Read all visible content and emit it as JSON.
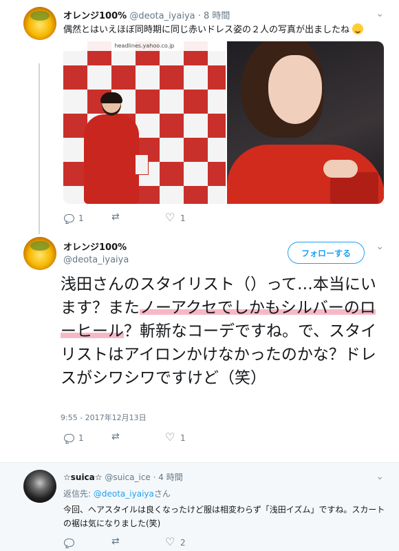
{
  "tweet1": {
    "name": "オレンジ100%",
    "handle": "@deota_iyaiya",
    "time": "· 8 時間",
    "text": "偶然とはいえほぼ同時期に同じ赤いドレス姿の２人の写真が出ましたね",
    "emoji_icon": "smiling-face-icon",
    "media_url_text": "headlines.yahoo.co.jp",
    "reply_count": "1",
    "retweet_count": "",
    "like_count": "1"
  },
  "tweet2": {
    "name": "オレンジ100%",
    "handle": "@deota_iyaiya",
    "follow_label": "フォローする",
    "text_before": "浅田さんのスタイリスト（）って…本当にいます？また",
    "text_highlight": "ノーアクセでしかもシルバーのローヒール",
    "text_after": "？斬新なコーデですね。で、スタイリストはアイロンかけなかったのかな？ドレスがシワシワですけど（笑）",
    "highlight_color": "#f6b8c4",
    "timestamp": "9:55 - 2017年12月13日",
    "reply_count": "1",
    "retweet_count": "",
    "like_count": "1"
  },
  "tweet3": {
    "name": "☆suica☆",
    "handle": "@suica_ice",
    "time": "· 4 時間",
    "replying_label": "返信先:",
    "replying_to": "@deota_iyaiya",
    "replying_suffix": "さん",
    "text": "今回、ヘアスタイルは良くなったけど服は相変わらず「浅田イズム」ですね。スカートの裾は気になりました(笑)",
    "reply_count": "",
    "retweet_count": "",
    "like_count": "2"
  },
  "colors": {
    "accent": "#1da1f2",
    "muted": "#657786"
  }
}
